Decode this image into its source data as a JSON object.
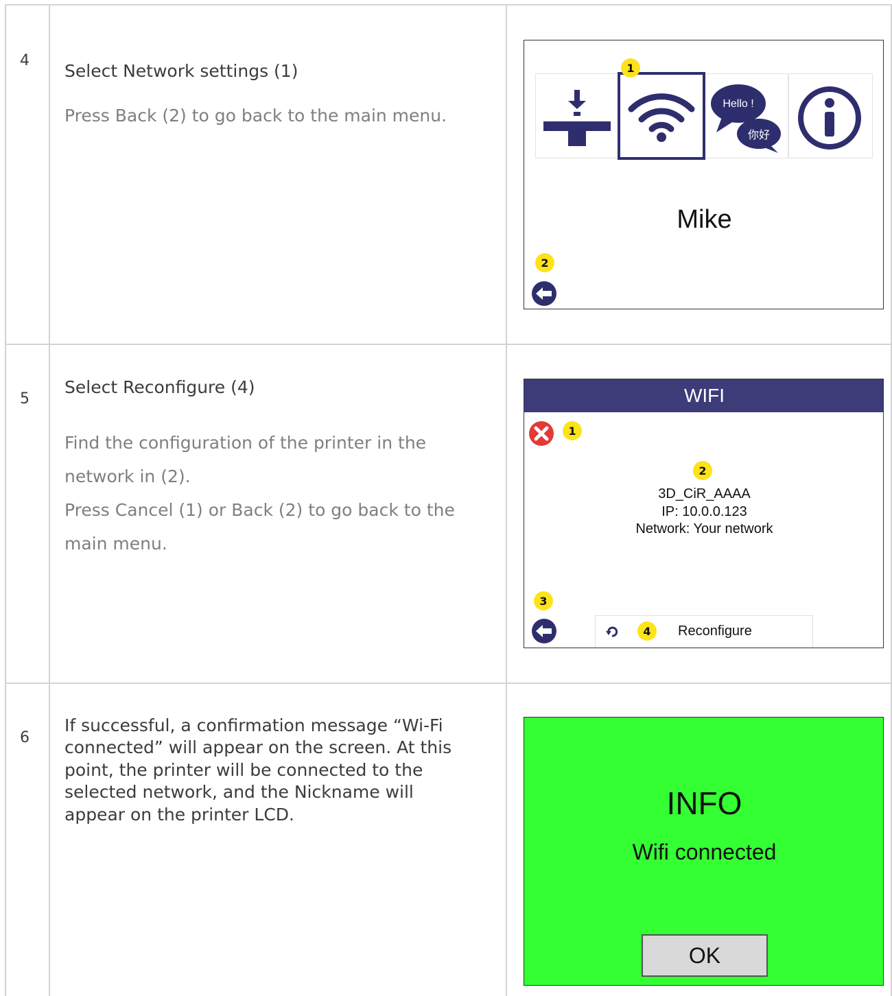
{
  "rows": [
    {
      "number": "4",
      "line1": "Select Network settings (1)",
      "line2": "Press Back (2) to go back to the main menu.",
      "screen": {
        "name": "Mike",
        "badge_network": "1",
        "badge_back": "2",
        "hello_text": "Hello !",
        "chinese_text": "你好"
      }
    },
    {
      "number": "5",
      "line1": "Select Reconfigure (4)",
      "line2": "Find the configuration of the printer in the",
      "line3": "network in (2).",
      "line4": "Press Cancel (1) or Back (2) to go back to the",
      "line5": "main menu.",
      "screen": {
        "title": "WIFI",
        "badge_cancel": "1",
        "badge_info": "2",
        "badge_back": "3",
        "badge_reconfigure": "4",
        "device_name": "3D_CiR_AAAA",
        "ip": "IP: 10.0.0.123",
        "network": "Network: Your network",
        "reconfigure_label": "Reconfigure"
      }
    },
    {
      "number": "6",
      "lines": [
        "If successful, a confirmation message “Wi-Fi",
        "connected” will appear on the screen. At this",
        "point, the printer will be connected to the",
        "selected network, and the Nickname will",
        "appear on the printer LCD."
      ],
      "screen": {
        "title": "INFO",
        "message": "Wifi connected",
        "ok_label": "OK",
        "background": "#33ff33"
      }
    }
  ],
  "colors": {
    "accent": "#2e2e6e",
    "badge": "#fce31b",
    "grid": "#d3d3d3"
  }
}
